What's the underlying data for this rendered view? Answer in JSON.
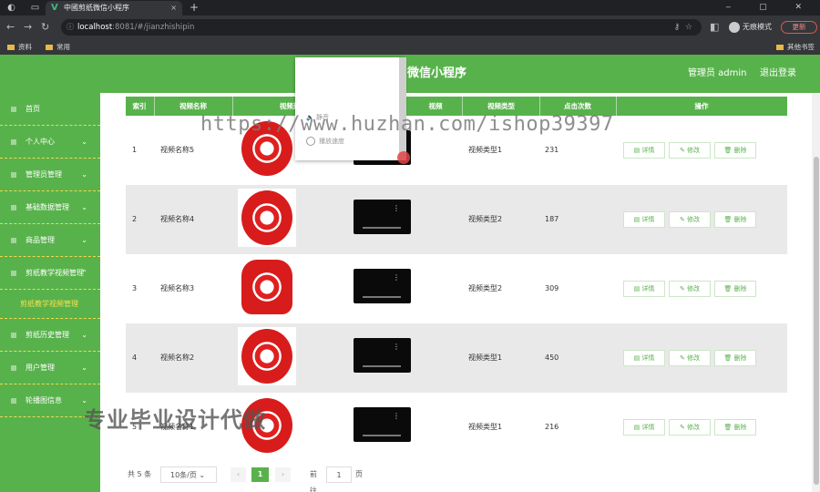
{
  "browser": {
    "tab_title": "中國剪纸微信小程序",
    "tab_favicon": "V",
    "url_host": "localhost",
    "url_rest": ":8081/#/jianzhishipin",
    "incognito_label": "无痕模式",
    "update_label": "更新",
    "bookmarks": [
      {
        "label": "资料"
      },
      {
        "label": "常用"
      }
    ],
    "other_bookmarks_label": "其他书签"
  },
  "header": {
    "title": "微信小程序",
    "user_label": "管理员 admin",
    "logout_label": "退出登录"
  },
  "sidebar": {
    "items": [
      {
        "label": "首页"
      },
      {
        "label": "个人中心"
      },
      {
        "label": "管理员管理"
      },
      {
        "label": "基础数据管理"
      },
      {
        "label": "商品管理"
      },
      {
        "label": "剪纸教学视频管理"
      },
      {
        "label": "剪纸教学视频管理",
        "active": true
      },
      {
        "label": "剪纸历史管理"
      },
      {
        "label": "用户管理"
      },
      {
        "label": "轮播图信息"
      }
    ]
  },
  "table": {
    "columns": [
      "索引",
      "视频名称",
      "视频封",
      "视频",
      "视频类型",
      "点击次数",
      "操作"
    ],
    "rows": [
      {
        "index": "1",
        "name": "视频名称5",
        "type": "视频类型1",
        "clicks": "231"
      },
      {
        "index": "2",
        "name": "视频名称4",
        "type": "视频类型2",
        "clicks": "187"
      },
      {
        "index": "3",
        "name": "视频名称3",
        "type": "视频类型2",
        "clicks": "309"
      },
      {
        "index": "4",
        "name": "视频名称2",
        "type": "视频类型1",
        "clicks": "450"
      },
      {
        "index": "5",
        "name": "视频名称1",
        "type": "视频类型1",
        "clicks": "216"
      }
    ],
    "actions": {
      "detail": "详情",
      "edit": "修改",
      "delete": "删除"
    }
  },
  "popup": {
    "items": [
      {
        "label": "静音"
      },
      {
        "label": "播放速度"
      }
    ]
  },
  "pagination": {
    "total_label": "共 5 条",
    "page_size_label": "10条/页",
    "current_page": "1",
    "goto_label": "前往",
    "goto_value": "1",
    "page_suffix": "页"
  },
  "watermarks": {
    "url": "https://www.huzhan.com/ishop39397",
    "text": "专业毕业设计代做"
  },
  "colors": {
    "accent": "#58b24c",
    "menu_separator": "#f1d94a",
    "active_menu_text": "#f7e14f"
  }
}
